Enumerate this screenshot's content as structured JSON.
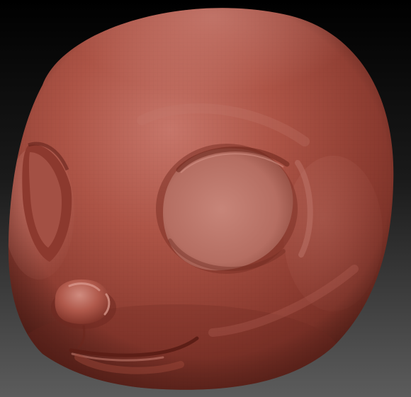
{
  "scene": {
    "subject": "sculpted-creature-head",
    "material_color": "#a84d3f",
    "background_top": "#000000",
    "background_bottom": "#5a5a5a"
  }
}
